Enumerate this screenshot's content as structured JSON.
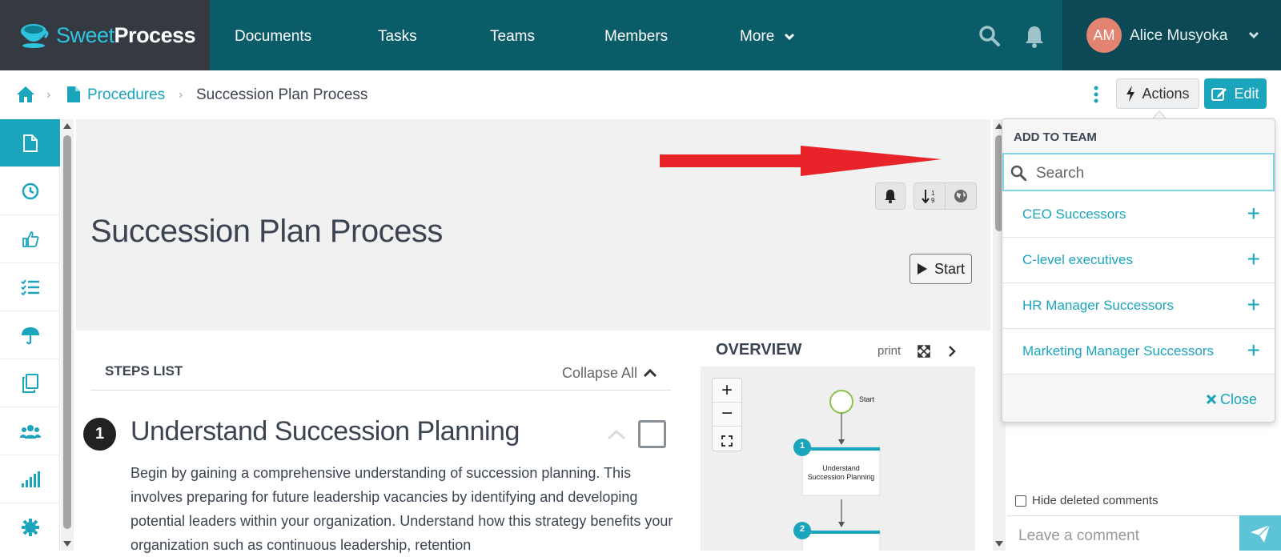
{
  "app": {
    "logo_light": "Sweet",
    "logo_bold": "Process"
  },
  "nav": {
    "items": [
      "Documents",
      "Tasks",
      "Teams",
      "Members",
      "More"
    ],
    "user_initials": "AM",
    "user_name": "Alice Musyoka"
  },
  "breadcrumb": {
    "root": "Procedures",
    "current": "Succession Plan Process"
  },
  "toolbar": {
    "actions_label": "Actions",
    "edit_label": "Edit"
  },
  "procedure": {
    "title": "Succession Plan Process",
    "start_label": "Start"
  },
  "steps": {
    "header": "STEPS LIST",
    "collapse_label": "Collapse All",
    "first_number": "1",
    "first_title": "Understand Succession Planning",
    "first_body": "Begin by gaining a comprehensive understanding of succession planning. This involves preparing for future leadership vacancies by identifying and developing potential leaders within your organization. Understand how this strategy benefits your organization such as continuous leadership, retention"
  },
  "overview": {
    "title": "OVERVIEW",
    "print_label": "print",
    "flow_start": "Start",
    "node1_number": "1",
    "node1_label_line1": "Understand",
    "node1_label_line2": "Succession Planning",
    "node2_number": "2"
  },
  "add_to_team": {
    "header": "ADD TO TEAM",
    "search_placeholder": "Search",
    "teams": [
      {
        "name": "CEO Successors"
      },
      {
        "name": "C-level executives"
      },
      {
        "name": "HR Manager Successors"
      },
      {
        "name": "Marketing Manager Successors"
      }
    ],
    "close_label": "Close"
  },
  "comments": {
    "hide_deleted_label": "Hide deleted comments",
    "placeholder": "Leave a comment"
  },
  "colors": {
    "nav_bg": "#0a5c68",
    "accent": "#1aa5bd",
    "arrow": "#e8242a"
  }
}
